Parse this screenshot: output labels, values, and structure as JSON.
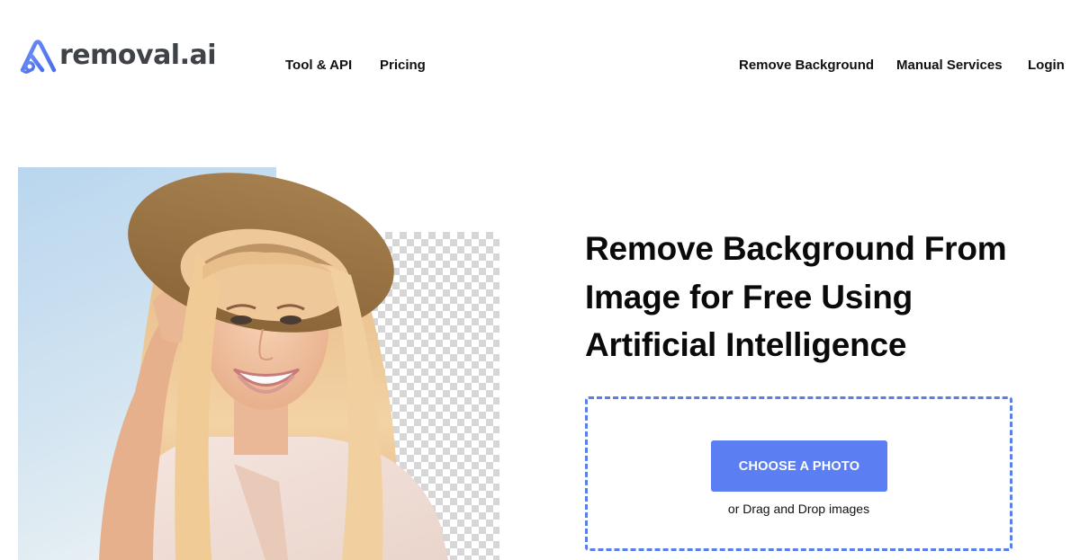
{
  "brand": {
    "name": "removal.ai",
    "logo_icon": "removal-ai-logo-icon",
    "accent_color": "#5b7ff2",
    "logo_text_color": "#3f4246"
  },
  "nav": {
    "left": [
      {
        "label": "Tool & API"
      },
      {
        "label": "Pricing"
      }
    ],
    "right": [
      {
        "label": "Remove Background"
      },
      {
        "label": "Manual Services"
      },
      {
        "label": "Login"
      }
    ]
  },
  "hero": {
    "title_lines": [
      "Remove Background From",
      "Image for Free Using",
      "Artificial Intelligence"
    ],
    "image_description": "Smiling woman with long blonde hair in a straw hat; left half on blue sky background, right half on transparent checkerboard",
    "upload": {
      "button_label": "CHOOSE A PHOTO",
      "hint": "or Drag and Drop images",
      "border_color": "#5b7fe8",
      "button_color": "#5b7ff2"
    }
  }
}
